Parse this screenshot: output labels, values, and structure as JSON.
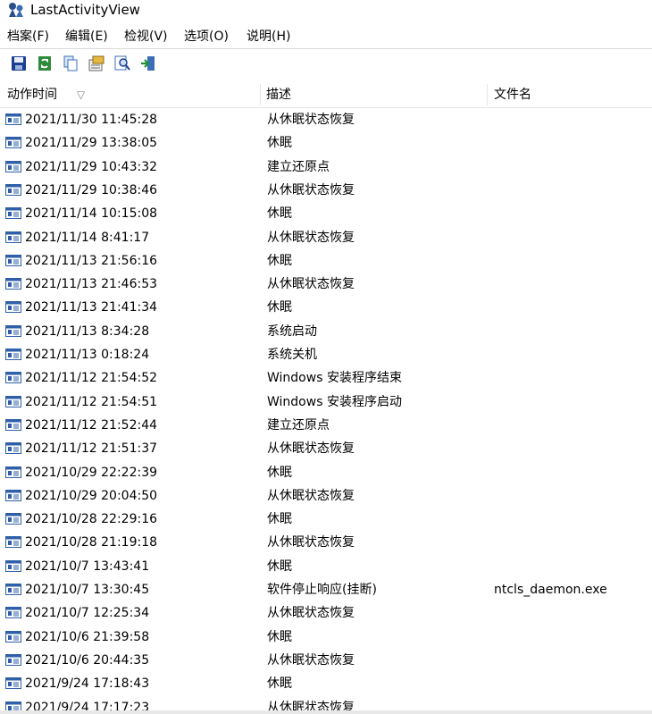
{
  "window": {
    "title": "LastActivityView"
  },
  "menu": [
    "档案(F)",
    "编辑(E)",
    "检视(V)",
    "选项(O)",
    "说明(H)"
  ],
  "toolbar": [
    {
      "icon": "save-icon"
    },
    {
      "icon": "refresh-icon"
    },
    {
      "icon": "copy-icon"
    },
    {
      "icon": "properties-icon"
    },
    {
      "icon": "find-icon"
    },
    {
      "icon": "exit-icon"
    }
  ],
  "columns": {
    "time": "动作时间",
    "sort_indicator": "▽",
    "desc": "描述",
    "file": "文件名"
  },
  "rows": [
    {
      "time": "2021/11/30 11:45:28",
      "desc": "从休眠状态恢复",
      "file": ""
    },
    {
      "time": "2021/11/29 13:38:05",
      "desc": "休眠",
      "file": ""
    },
    {
      "time": "2021/11/29 10:43:32",
      "desc": "建立还原点",
      "file": ""
    },
    {
      "time": "2021/11/29 10:38:46",
      "desc": "从休眠状态恢复",
      "file": ""
    },
    {
      "time": "2021/11/14 10:15:08",
      "desc": "休眠",
      "file": ""
    },
    {
      "time": "2021/11/14 8:41:17",
      "desc": "从休眠状态恢复",
      "file": ""
    },
    {
      "time": "2021/11/13 21:56:16",
      "desc": "休眠",
      "file": ""
    },
    {
      "time": "2021/11/13 21:46:53",
      "desc": "从休眠状态恢复",
      "file": ""
    },
    {
      "time": "2021/11/13 21:41:34",
      "desc": "休眠",
      "file": ""
    },
    {
      "time": "2021/11/13 8:34:28",
      "desc": "系统启动",
      "file": ""
    },
    {
      "time": "2021/11/13 0:18:24",
      "desc": "系统关机",
      "file": ""
    },
    {
      "time": "2021/11/12 21:54:52",
      "desc": "Windows 安装程序结束",
      "file": ""
    },
    {
      "time": "2021/11/12 21:54:51",
      "desc": "Windows 安装程序启动",
      "file": ""
    },
    {
      "time": "2021/11/12 21:52:44",
      "desc": "建立还原点",
      "file": ""
    },
    {
      "time": "2021/11/12 21:51:37",
      "desc": "从休眠状态恢复",
      "file": ""
    },
    {
      "time": "2021/10/29 22:22:39",
      "desc": "休眠",
      "file": ""
    },
    {
      "time": "2021/10/29 20:04:50",
      "desc": "从休眠状态恢复",
      "file": ""
    },
    {
      "time": "2021/10/28 22:29:16",
      "desc": "休眠",
      "file": ""
    },
    {
      "time": "2021/10/28 21:19:18",
      "desc": "从休眠状态恢复",
      "file": ""
    },
    {
      "time": "2021/10/7 13:43:41",
      "desc": "休眠",
      "file": ""
    },
    {
      "time": "2021/10/7 13:30:45",
      "desc": "软件停止响应(挂断)",
      "file": "ntcls_daemon.exe"
    },
    {
      "time": "2021/10/7 12:25:34",
      "desc": "从休眠状态恢复",
      "file": ""
    },
    {
      "time": "2021/10/6 21:39:58",
      "desc": "休眠",
      "file": ""
    },
    {
      "time": "2021/10/6 20:44:35",
      "desc": "从休眠状态恢复",
      "file": ""
    },
    {
      "time": "2021/9/24 17:18:43",
      "desc": "休眠",
      "file": ""
    },
    {
      "time": "2021/9/24 17:17:23",
      "desc": "从休眠状态恢复",
      "file": ""
    }
  ]
}
